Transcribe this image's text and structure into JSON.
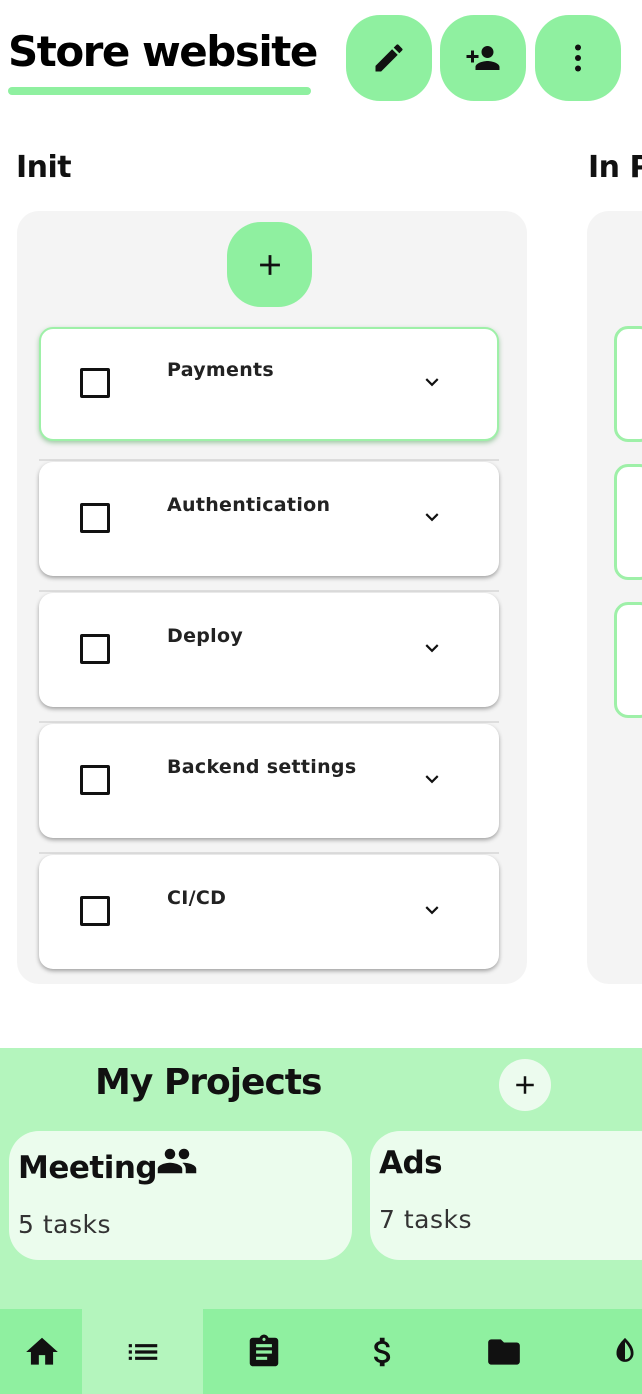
{
  "header": {
    "title": "Store website",
    "actions": [
      {
        "name": "edit-button",
        "icon": "pencil-icon"
      },
      {
        "name": "add-member-button",
        "icon": "person-add-icon"
      },
      {
        "name": "more-options-button",
        "icon": "more-vert-icon"
      }
    ]
  },
  "columns": [
    {
      "title": "Init",
      "tasks": [
        {
          "label": "Payments",
          "checked": false,
          "selected": true
        },
        {
          "label": "Authentication",
          "checked": false,
          "selected": false
        },
        {
          "label": "Deploy",
          "checked": false,
          "selected": false
        },
        {
          "label": "Backend settings",
          "checked": false,
          "selected": false
        },
        {
          "label": "CI/CD",
          "checked": false,
          "selected": false
        }
      ]
    },
    {
      "title": "In P"
    }
  ],
  "projects": {
    "title": "My Projects",
    "items": [
      {
        "name": "Meeting",
        "count": "5 tasks",
        "shared": true
      },
      {
        "name": "Ads",
        "count": "7 tasks",
        "shared": false
      }
    ]
  },
  "nav": [
    {
      "icon": "home-icon",
      "active": false
    },
    {
      "icon": "list-icon",
      "active": true
    },
    {
      "icon": "clipboard-icon",
      "active": false
    },
    {
      "icon": "dollar-icon",
      "active": false
    },
    {
      "icon": "folder-icon",
      "active": false
    },
    {
      "icon": "contrast-icon",
      "active": false
    }
  ],
  "colors": {
    "accent": "#8ff0a0",
    "accent_light": "#b4f5bd",
    "card_light": "#ebfced",
    "column_bg": "#f4f4f4"
  }
}
